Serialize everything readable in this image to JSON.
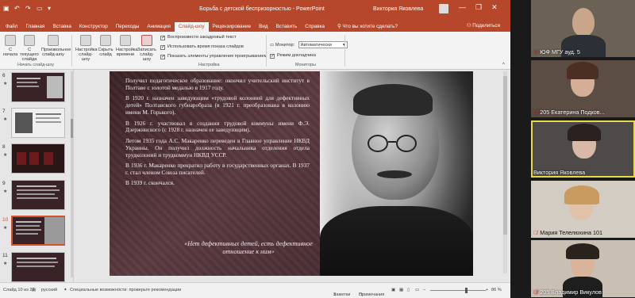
{
  "window": {
    "title": "Борьба с детской беспризорностью  -  PowerPoint",
    "user": "Виктория Яковлева",
    "controls": [
      "—",
      "❐",
      "✕"
    ]
  },
  "ribbon": {
    "tabs": [
      "Файл",
      "Главная",
      "Вставка",
      "Конструктор",
      "Переходы",
      "Анимация",
      "Слайд-шоу",
      "Рецензирование",
      "Вид",
      "Вставить",
      "Справка"
    ],
    "active_tab": "Слайд-шоу",
    "tell_me": "Что вы хотите сделать?",
    "share": "Поделиться",
    "buttons": {
      "from_start": "С начала",
      "from_current": "С текущего слайда",
      "custom": "Произвольное слайд-шоу",
      "setup": "Настройка слайд-шоу",
      "hide": "Скрыть слайд",
      "rehearse": "Настройка времени",
      "record": "Записать слайд-шоу"
    },
    "checkboxes": [
      {
        "label": "Воспроизвести закадровый текст",
        "checked": true
      },
      {
        "label": "Использовать время показа слайдов",
        "checked": true
      },
      {
        "label": "Показать элементы управления проигрыванием",
        "checked": true
      }
    ],
    "monitor_label": "Монитор:",
    "monitor_value": "Автоматически",
    "presenter_view": "Режим докладчика",
    "groups": {
      "start": "Начать слайд-шоу",
      "setup": "Настройка",
      "monitors": "Мониторы"
    }
  },
  "thumbnails": {
    "items": [
      {
        "num": "6",
        "active": false
      },
      {
        "num": "7",
        "active": false
      },
      {
        "num": "8",
        "active": false
      },
      {
        "num": "9",
        "active": false
      },
      {
        "num": "10",
        "active": true
      },
      {
        "num": "11",
        "active": false
      }
    ]
  },
  "slide": {
    "paragraphs": [
      "Получил педагогическое образование: окончил учительский институт в Полтаве с золотой медалью в 1917 году.",
      "В 1920 г. назначен заведующим «трудовой колонией для дефективных детей» Полтавского губнаробраза (в 1921 г. преобразована в колонию имени М. Горького).",
      "В 1926 г. участвовал в создании трудовой коммуны имени Ф.Э. Дзержинского (с 1928 г. назначен ее заведующим).",
      "Летом 1935 года А.С. Макаренко переведен в Главное управление НКВД Украины. Он получил должность начальника отделения отдела трудколоний и трудкоммун НКВД УССР.",
      "В 1936 г. Макаренко прекратил работу в государственных органах. В 1937 г. стал членом Союза писателей.",
      "В 1939 г. скончался."
    ],
    "quote": "«Нет дефективных детей, есть дефективное отношение к ним»"
  },
  "statusbar": {
    "slide_info": "Слайд 10 из 22",
    "language": "русский",
    "accessibility": "Специальные возможности: проверьте рекомендации",
    "notes": "Заметки",
    "comments": "Примечания",
    "zoom": "86 %"
  },
  "participants": [
    {
      "name": "ЮФ МГУ ауд. 5",
      "muted": true,
      "active": false,
      "bg": "#6b6255"
    },
    {
      "name": "205 Екатерина Подков...",
      "muted": true,
      "active": false,
      "bg": "#5c4d44"
    },
    {
      "name": "Виктория Яковлева",
      "muted": false,
      "active": true,
      "bg": "#4d4a49"
    },
    {
      "name": "Мария Телелюхина 101",
      "muted": true,
      "active": false,
      "bg": "#d3ccc2"
    },
    {
      "name": "205 Владимир Викулов",
      "muted": true,
      "active": false,
      "bg": "#c9c0b3"
    }
  ],
  "colors": {
    "accent": "#b7472a",
    "active_speaker": "#e6d94e",
    "slide_bg": "#3b2226"
  }
}
